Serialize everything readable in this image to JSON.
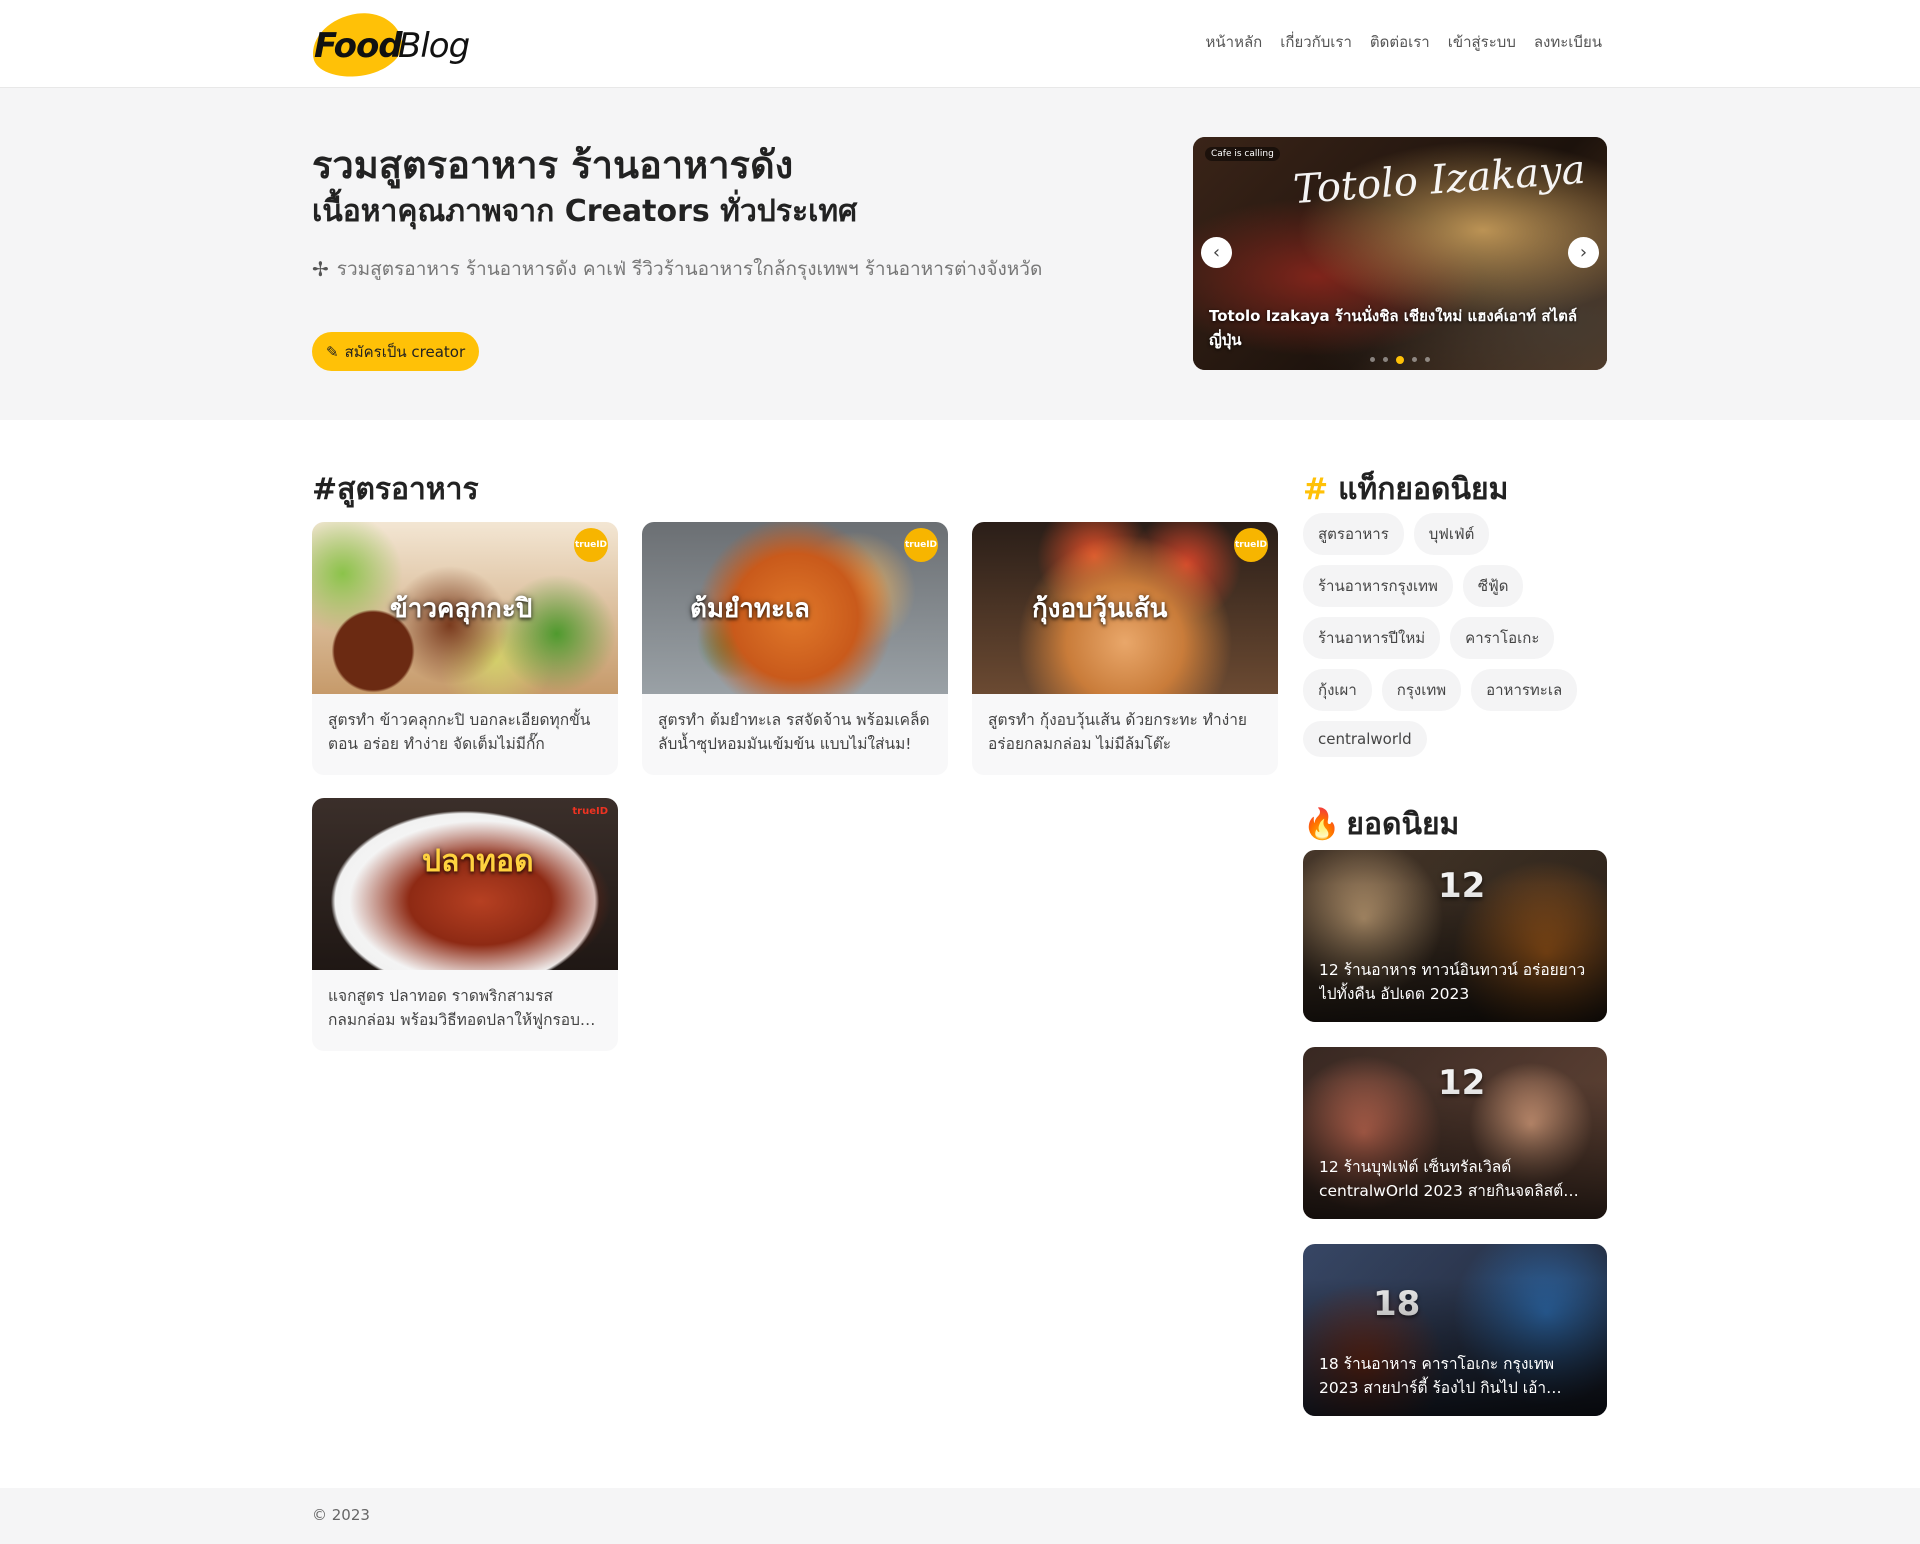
{
  "brand": {
    "logo_word1": "Food",
    "logo_word2": "Blog",
    "accent": "#ffc107"
  },
  "nav": {
    "items": [
      "หน้าหลัก",
      "เกี่ยวกับเรา",
      "ติดต่อเรา",
      "เข้าสู่ระบบ",
      "ลงทะเบียน"
    ]
  },
  "hero": {
    "title": "รวมสูตรอาหาร ร้านอาหารดัง",
    "subtitle": "เนื้อหาคุณภาพจาก Creators ทั่วประเทศ",
    "description": "รวมสูตรอาหาร ร้านอาหารดัง คาเฟ่ รีวิวร้านอาหารใกล้กรุงเทพฯ ร้านอาหารต่างจังหวัด",
    "cta_label": "สมัครเป็น creator",
    "carousel": {
      "script_title": "Totolo Izakaya",
      "tag": "Cafe is calling",
      "caption": "Totolo Izakaya ร้านนั่งชิล เชียงใหม่ แฮงค์เอาท์ สไตล์ญี่ปุ่น",
      "slide_count": 5,
      "active_slide": 3
    }
  },
  "recipes": {
    "title": "#สูตรอาหาร",
    "cards": [
      {
        "image_label": "ข้าวคลุกกะปิ",
        "badge": "trueID",
        "text": "สูตรทำ ข้าวคลุกกะปิ บอกละเอียดทุกขั้นตอน อร่อย ทำง่าย จัดเต็มไม่มีกั๊ก"
      },
      {
        "image_label": "ต้มยำทะเล",
        "badge": "trueID",
        "text": "สูตรทำ ต้มยำทะเล รสจัดจ้าน พร้อมเคล็ดลับน้ำซุปหอมมันเข้มข้น แบบไม่ใส่นม!"
      },
      {
        "image_label": "กุ้งอบวุ้นเส้น",
        "badge": "trueID",
        "text": "สูตรทำ กุ้งอบวุ้นเส้น ด้วยกระทะ ทำง่าย อร่อยกลมกล่อม ไม่มีล้มโต๊ะ"
      },
      {
        "image_label": "ปลาทอด",
        "badge": "trueID",
        "text": "แจกสูตร ปลาทอด ราดพริกสามรส กลมกล่อม พร้อมวิธีทอดปลาให้ฟูกรอบ ไม่อมน้ำมัน"
      }
    ]
  },
  "tags": {
    "title": "แท็กยอดนิยม",
    "items": [
      "สูตรอาหาร",
      "บุฟเฟ่ต์",
      "ร้านอาหารกรุงเทพ",
      "ซีฟู้ด",
      "ร้านอาหารปีใหม่",
      "คาราโอเกะ",
      "กุ้งเผา",
      "กรุงเทพ",
      "อาหารทะเล",
      "centralworld"
    ]
  },
  "popular": {
    "title": "ยอดนิยม",
    "items": [
      {
        "big": "12",
        "text": "12 ร้านอาหาร ทาวน์อินทาวน์ อร่อยยาวไปทั้งคืน อัปเดต 2023"
      },
      {
        "big": "12",
        "text": "12 ร้านบุฟเฟ่ต์ เซ็นทรัลเวิลด์ centralwOrld 2023 สายกินจดลิสต์ด่วน"
      },
      {
        "big": "18",
        "text": "18 ร้านอาหาร คาราโอเกะ กรุงเทพ 2023 สายปาร์ตี้ ร้องไป กินไป เอ้าชนนน!"
      }
    ]
  },
  "footer": {
    "copyright": "© 2023"
  }
}
